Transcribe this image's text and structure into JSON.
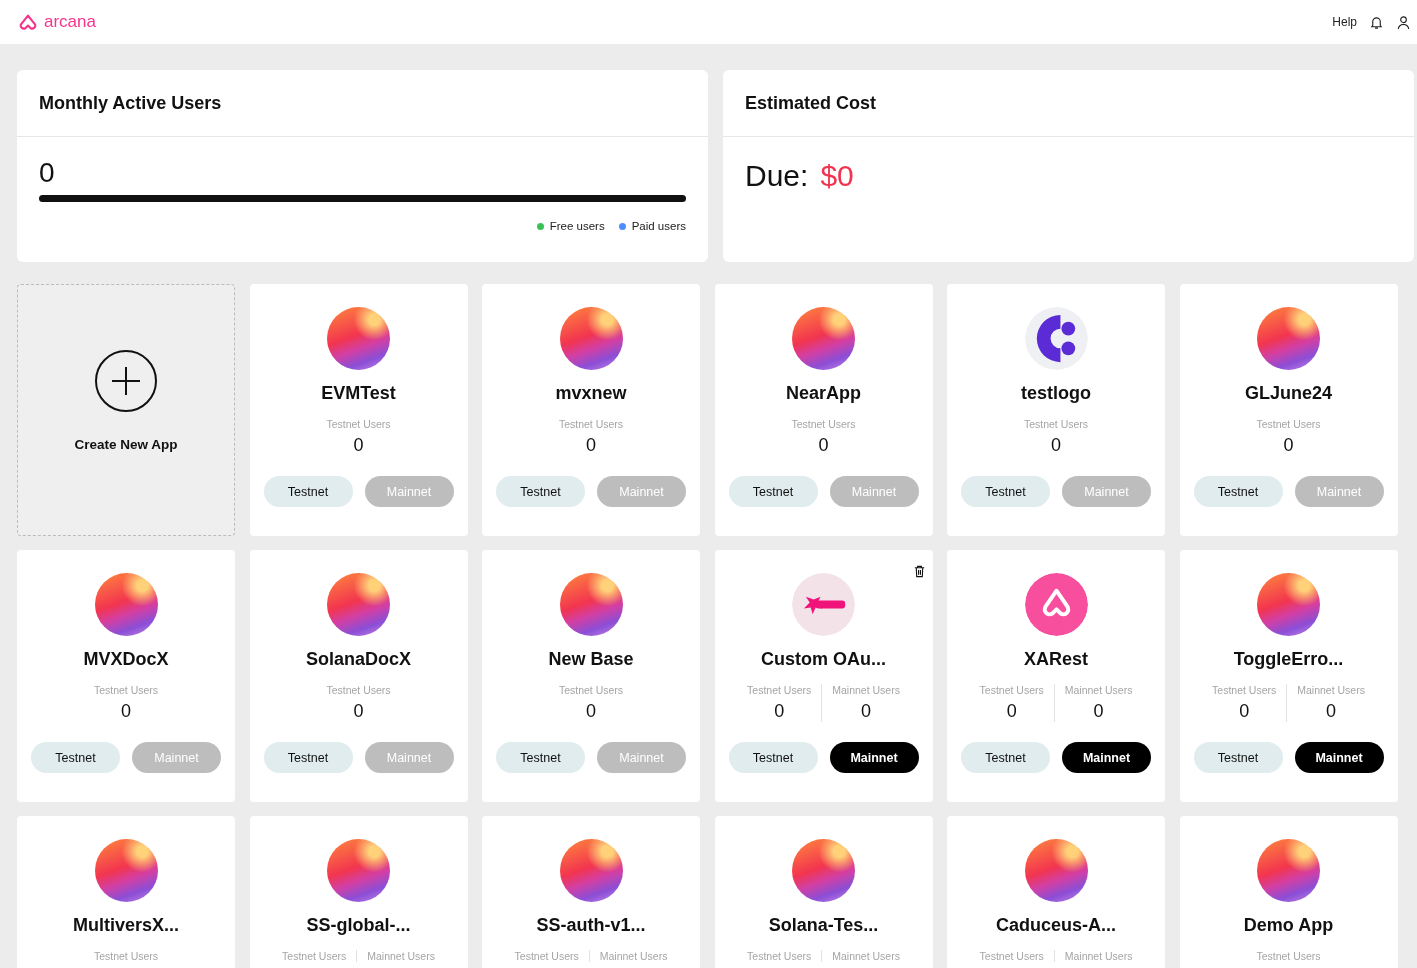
{
  "header": {
    "brand": "arcana",
    "help": "Help"
  },
  "mau": {
    "title": "Monthly Active Users",
    "count": "0",
    "level": 0,
    "legend": [
      {
        "label": "Free users",
        "color": "#3cc05a"
      },
      {
        "label": "Paid users",
        "color": "#4d8ef8"
      }
    ]
  },
  "cost": {
    "title": "Estimated Cost",
    "label": "Due:",
    "amount": "$0"
  },
  "create": {
    "label": "Create New App"
  },
  "apps": [
    {
      "name": "EVMTest",
      "kind": "gradient",
      "deletable": false,
      "stats": [
        {
          "label": "Testnet Users",
          "value": "0"
        }
      ],
      "buttons": [
        {
          "label": "Testnet",
          "kind": "testnet",
          "active": true
        },
        {
          "label": "Mainnet",
          "kind": "mainnet",
          "active": false
        }
      ]
    },
    {
      "name": "mvxnew",
      "kind": "gradient",
      "deletable": false,
      "stats": [
        {
          "label": "Testnet Users",
          "value": "0"
        }
      ],
      "buttons": [
        {
          "label": "Testnet",
          "kind": "testnet",
          "active": true
        },
        {
          "label": "Mainnet",
          "kind": "mainnet",
          "active": false
        }
      ]
    },
    {
      "name": "NearApp",
      "kind": "gradient",
      "deletable": false,
      "stats": [
        {
          "label": "Testnet Users",
          "value": "0"
        }
      ],
      "buttons": [
        {
          "label": "Testnet",
          "kind": "testnet",
          "active": true
        },
        {
          "label": "Mainnet",
          "kind": "mainnet",
          "active": false
        }
      ]
    },
    {
      "name": "testlogo",
      "kind": "letter",
      "deletable": false,
      "stats": [
        {
          "label": "Testnet Users",
          "value": "0"
        }
      ],
      "buttons": [
        {
          "label": "Testnet",
          "kind": "testnet",
          "active": true
        },
        {
          "label": "Mainnet",
          "kind": "mainnet",
          "active": false
        }
      ]
    },
    {
      "name": "GLJune24",
      "kind": "gradient",
      "deletable": false,
      "stats": [
        {
          "label": "Testnet Users",
          "value": "0"
        }
      ],
      "buttons": [
        {
          "label": "Testnet",
          "kind": "testnet",
          "active": true
        },
        {
          "label": "Mainnet",
          "kind": "mainnet",
          "active": false
        }
      ]
    },
    {
      "name": "MVXDocX",
      "kind": "gradient",
      "deletable": false,
      "stats": [
        {
          "label": "Testnet Users",
          "value": "0"
        }
      ],
      "buttons": [
        {
          "label": "Testnet",
          "kind": "testnet",
          "active": true
        },
        {
          "label": "Mainnet",
          "kind": "mainnet",
          "active": false
        }
      ]
    },
    {
      "name": "SolanaDocX",
      "kind": "gradient",
      "deletable": false,
      "stats": [
        {
          "label": "Testnet Users",
          "value": "0"
        }
      ],
      "buttons": [
        {
          "label": "Testnet",
          "kind": "testnet",
          "active": true
        },
        {
          "label": "Mainnet",
          "kind": "mainnet",
          "active": false
        }
      ]
    },
    {
      "name": "New Base",
      "kind": "gradient",
      "deletable": false,
      "stats": [
        {
          "label": "Testnet Users",
          "value": "0"
        }
      ],
      "buttons": [
        {
          "label": "Testnet",
          "kind": "testnet",
          "active": true
        },
        {
          "label": "Mainnet",
          "kind": "mainnet",
          "active": false
        }
      ]
    },
    {
      "name": "Custom OAu...",
      "kind": "oauth",
      "deletable": true,
      "stats": [
        {
          "label": "Testnet Users",
          "value": "0"
        },
        {
          "label": "Mainnet Users",
          "value": "0"
        }
      ],
      "buttons": [
        {
          "label": "Testnet",
          "kind": "testnet",
          "active": true
        },
        {
          "label": "Mainnet",
          "kind": "mainnet",
          "active": true
        }
      ]
    },
    {
      "name": "XARest",
      "kind": "arcana",
      "deletable": false,
      "stats": [
        {
          "label": "Testnet Users",
          "value": "0"
        },
        {
          "label": "Mainnet Users",
          "value": "0"
        }
      ],
      "buttons": [
        {
          "label": "Testnet",
          "kind": "testnet",
          "active": true
        },
        {
          "label": "Mainnet",
          "kind": "mainnet",
          "active": true
        }
      ]
    },
    {
      "name": "ToggleErro...",
      "kind": "gradient",
      "deletable": false,
      "stats": [
        {
          "label": "Testnet Users",
          "value": "0"
        },
        {
          "label": "Mainnet Users",
          "value": "0"
        }
      ],
      "buttons": [
        {
          "label": "Testnet",
          "kind": "testnet",
          "active": true
        },
        {
          "label": "Mainnet",
          "kind": "mainnet",
          "active": true
        }
      ]
    },
    {
      "name": "MultiversX...",
      "kind": "gradient",
      "deletable": false,
      "stats": [
        {
          "label": "Testnet Users"
        }
      ]
    },
    {
      "name": "SS-global-...",
      "kind": "gradient",
      "deletable": false,
      "stats": [
        {
          "label": "Testnet Users"
        },
        {
          "label": "Mainnet Users"
        }
      ]
    },
    {
      "name": "SS-auth-v1...",
      "kind": "gradient",
      "deletable": false,
      "stats": [
        {
          "label": "Testnet Users"
        },
        {
          "label": "Mainnet Users"
        }
      ]
    },
    {
      "name": "Solana-Tes...",
      "kind": "gradient",
      "deletable": false,
      "stats": [
        {
          "label": "Testnet Users"
        },
        {
          "label": "Mainnet Users"
        }
      ]
    },
    {
      "name": "Caduceus-A...",
      "kind": "gradient",
      "deletable": false,
      "stats": [
        {
          "label": "Testnet Users"
        },
        {
          "label": "Mainnet Users"
        }
      ]
    },
    {
      "name": "Demo App",
      "kind": "gradient",
      "deletable": false,
      "stats": [
        {
          "label": "Testnet Users"
        }
      ]
    }
  ]
}
